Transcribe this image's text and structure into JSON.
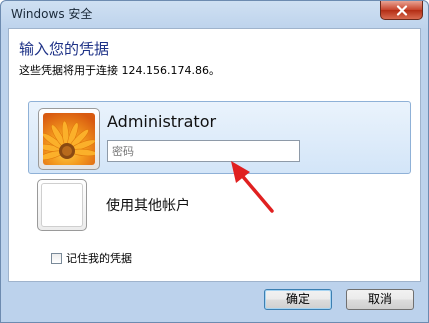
{
  "window": {
    "title": "Windows 安全"
  },
  "dialog": {
    "heading": "输入您的凭据",
    "description": "这些凭据将用于连接 124.156.174.86。"
  },
  "account": {
    "username": "Administrator",
    "password_placeholder": "密码"
  },
  "other_account": {
    "label": "使用其他帐户"
  },
  "remember": {
    "label": "记住我的凭据",
    "checked": false
  },
  "buttons": {
    "ok": "确定",
    "cancel": "取消"
  },
  "icons": {
    "close": "close-icon",
    "avatar": "flower-avatar-icon",
    "annotation": "red-arrow-icon"
  },
  "colors": {
    "heading": "#1e3287",
    "selected_tile": "#d3e5f8",
    "close_button": "#c7432a",
    "annotation_arrow": "#e02020"
  }
}
